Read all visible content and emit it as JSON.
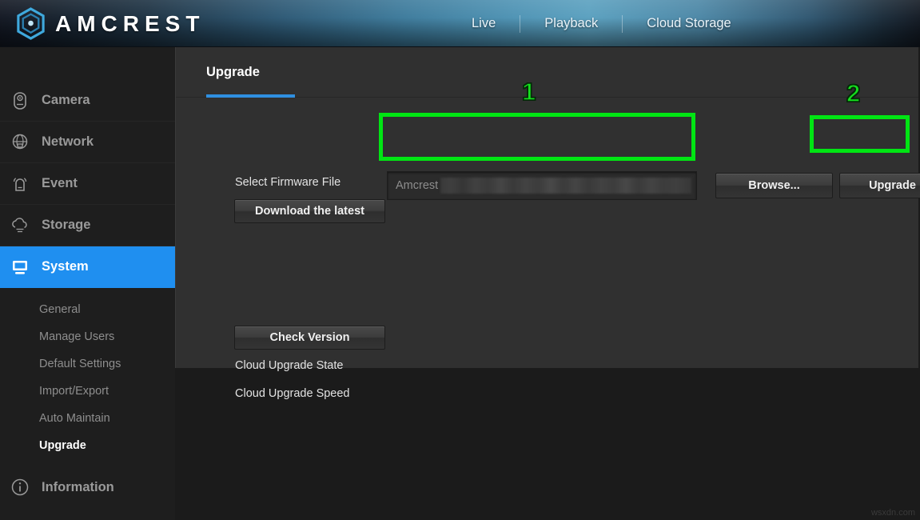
{
  "header": {
    "brand": "AMCREST",
    "logo_icon": "amcrest-hexagon-logo-icon",
    "nav": [
      {
        "label": "Live",
        "icon": "live-nav-item"
      },
      {
        "label": "Playback",
        "icon": "playback-nav-item"
      },
      {
        "label": "Cloud Storage",
        "icon": "cloud-storage-nav-item"
      }
    ],
    "accent_color": "#4e93b4"
  },
  "sidebar": {
    "items": [
      {
        "label": "Camera",
        "icon": "camera-icon",
        "active": false
      },
      {
        "label": "Network",
        "icon": "network-globe-icon",
        "active": false
      },
      {
        "label": "Event",
        "icon": "event-bell-icon",
        "active": false
      },
      {
        "label": "Storage",
        "icon": "storage-cloud-icon",
        "active": false
      },
      {
        "label": "System",
        "icon": "system-monitor-icon",
        "active": true
      }
    ],
    "sub_items": [
      {
        "label": "General",
        "active": false
      },
      {
        "label": "Manage Users",
        "active": false
      },
      {
        "label": "Default Settings",
        "active": false
      },
      {
        "label": "Import/Export",
        "active": false
      },
      {
        "label": "Auto Maintain",
        "active": false
      },
      {
        "label": "Upgrade",
        "active": true
      }
    ],
    "footer_item": {
      "label": "Information",
      "icon": "info-circle-icon"
    },
    "active_color": "#1f8ff0"
  },
  "content": {
    "tab": {
      "label": "Upgrade",
      "underline_color": "#2f8fe0"
    },
    "select_firmware_label": "Select Firmware File",
    "firmware_input": {
      "value": "Amcrest",
      "redacted": true,
      "placeholder": "Amcrest"
    },
    "download_latest_label": "Download the latest",
    "browse_label": "Browse...",
    "upgrade_label": "Upgrade",
    "check_version_label": "Check Version",
    "cloud_upgrade_state_label": "Cloud Upgrade State",
    "cloud_upgrade_speed_label": "Cloud Upgrade Speed"
  },
  "annotations": {
    "color": "#00e513",
    "marks": [
      {
        "number": "1",
        "target": "firmware-file-input"
      },
      {
        "number": "2",
        "target": "upgrade-button"
      }
    ]
  },
  "watermark": "wsxdn.com"
}
